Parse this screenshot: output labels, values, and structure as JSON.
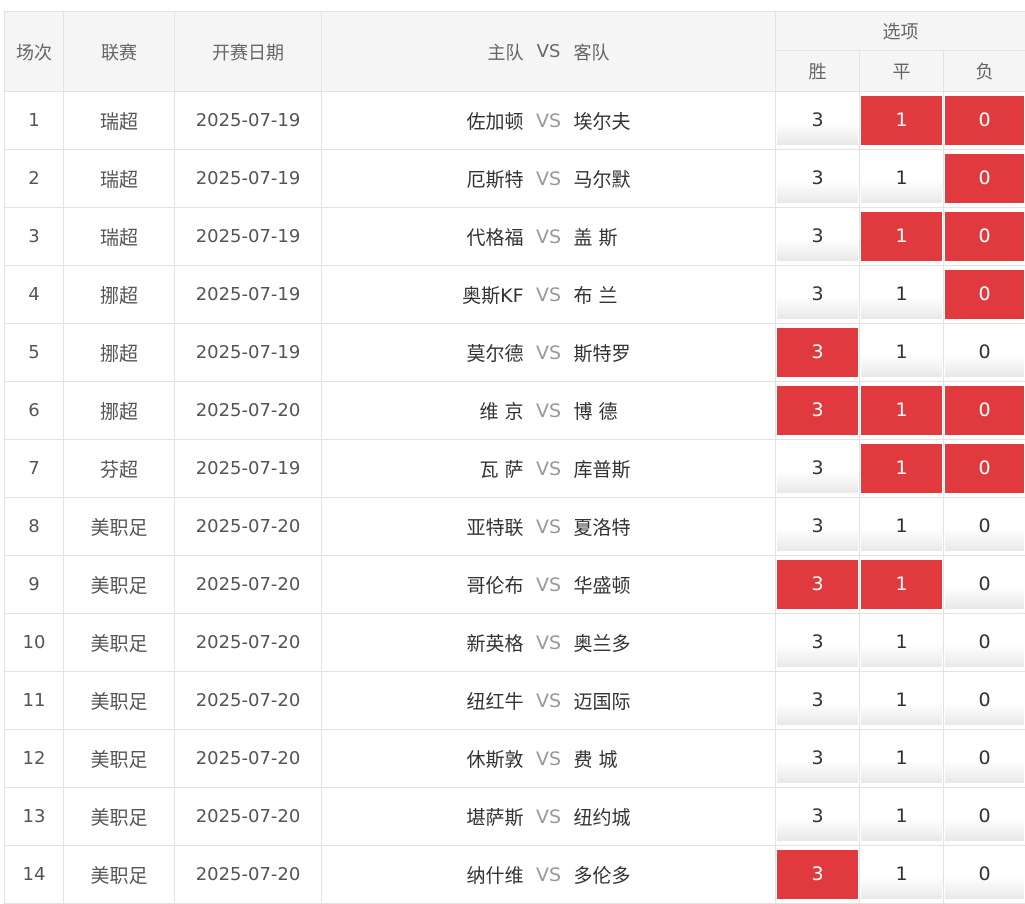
{
  "header": {
    "col_round": "场次",
    "col_league": "联赛",
    "col_date": "开赛日期",
    "col_home": "主队",
    "col_vs": "VS",
    "col_away": "客队",
    "col_options": "选项",
    "opt_win": "胜",
    "opt_draw": "平",
    "opt_lose": "负"
  },
  "accent_color": "#e03a3e",
  "rows": [
    {
      "no": "1",
      "league": "瑞超",
      "date": "2025-07-19",
      "home": "佐加顿",
      "vs": "VS",
      "away": "埃尔夫",
      "w": "3",
      "d": "1",
      "l": "0",
      "sel": [
        false,
        true,
        true
      ]
    },
    {
      "no": "2",
      "league": "瑞超",
      "date": "2025-07-19",
      "home": "厄斯特",
      "vs": "VS",
      "away": "马尔默",
      "w": "3",
      "d": "1",
      "l": "0",
      "sel": [
        false,
        false,
        true
      ]
    },
    {
      "no": "3",
      "league": "瑞超",
      "date": "2025-07-19",
      "home": "代格福",
      "vs": "VS",
      "away": "盖 斯",
      "w": "3",
      "d": "1",
      "l": "0",
      "sel": [
        false,
        true,
        true
      ]
    },
    {
      "no": "4",
      "league": "挪超",
      "date": "2025-07-19",
      "home": "奥斯KF",
      "vs": "VS",
      "away": "布 兰",
      "w": "3",
      "d": "1",
      "l": "0",
      "sel": [
        false,
        false,
        true
      ]
    },
    {
      "no": "5",
      "league": "挪超",
      "date": "2025-07-19",
      "home": "莫尔德",
      "vs": "VS",
      "away": "斯特罗",
      "w": "3",
      "d": "1",
      "l": "0",
      "sel": [
        true,
        false,
        false
      ]
    },
    {
      "no": "6",
      "league": "挪超",
      "date": "2025-07-20",
      "home": "维 京",
      "vs": "VS",
      "away": "博 德",
      "w": "3",
      "d": "1",
      "l": "0",
      "sel": [
        true,
        true,
        true
      ]
    },
    {
      "no": "7",
      "league": "芬超",
      "date": "2025-07-19",
      "home": "瓦 萨",
      "vs": "VS",
      "away": "库普斯",
      "w": "3",
      "d": "1",
      "l": "0",
      "sel": [
        false,
        true,
        true
      ]
    },
    {
      "no": "8",
      "league": "美职足",
      "date": "2025-07-20",
      "home": "亚特联",
      "vs": "VS",
      "away": "夏洛特",
      "w": "3",
      "d": "1",
      "l": "0",
      "sel": [
        false,
        false,
        false
      ]
    },
    {
      "no": "9",
      "league": "美职足",
      "date": "2025-07-20",
      "home": "哥伦布",
      "vs": "VS",
      "away": "华盛顿",
      "w": "3",
      "d": "1",
      "l": "0",
      "sel": [
        true,
        true,
        false
      ]
    },
    {
      "no": "10",
      "league": "美职足",
      "date": "2025-07-20",
      "home": "新英格",
      "vs": "VS",
      "away": "奥兰多",
      "w": "3",
      "d": "1",
      "l": "0",
      "sel": [
        false,
        false,
        false
      ]
    },
    {
      "no": "11",
      "league": "美职足",
      "date": "2025-07-20",
      "home": "纽红牛",
      "vs": "VS",
      "away": "迈国际",
      "w": "3",
      "d": "1",
      "l": "0",
      "sel": [
        false,
        false,
        false
      ]
    },
    {
      "no": "12",
      "league": "美职足",
      "date": "2025-07-20",
      "home": "休斯敦",
      "vs": "VS",
      "away": "费 城",
      "w": "3",
      "d": "1",
      "l": "0",
      "sel": [
        false,
        false,
        false
      ]
    },
    {
      "no": "13",
      "league": "美职足",
      "date": "2025-07-20",
      "home": "堪萨斯",
      "vs": "VS",
      "away": "纽约城",
      "w": "3",
      "d": "1",
      "l": "0",
      "sel": [
        false,
        false,
        false
      ]
    },
    {
      "no": "14",
      "league": "美职足",
      "date": "2025-07-20",
      "home": "纳什维",
      "vs": "VS",
      "away": "多伦多",
      "w": "3",
      "d": "1",
      "l": "0",
      "sel": [
        true,
        false,
        false
      ]
    }
  ]
}
